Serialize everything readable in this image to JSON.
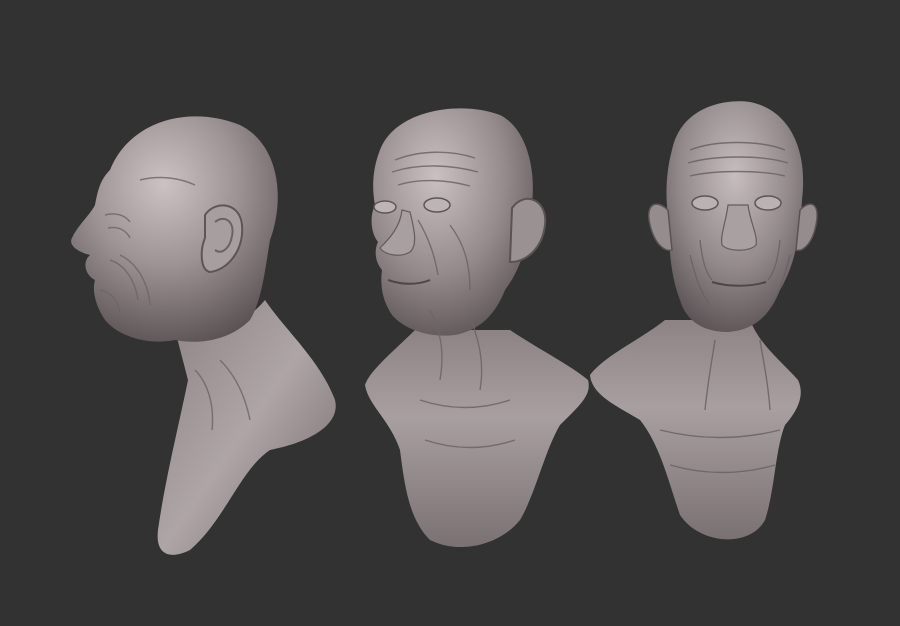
{
  "scene": {
    "background_color": "#323232",
    "material_color": "#8f8587",
    "highlight_color": "#cfc6c8",
    "shadow_color": "#4a4244",
    "views": [
      {
        "name": "profile-left",
        "icon": "bust-side-view"
      },
      {
        "name": "three-quarter",
        "icon": "bust-three-quarter-view"
      },
      {
        "name": "front",
        "icon": "bust-front-view"
      }
    ]
  }
}
